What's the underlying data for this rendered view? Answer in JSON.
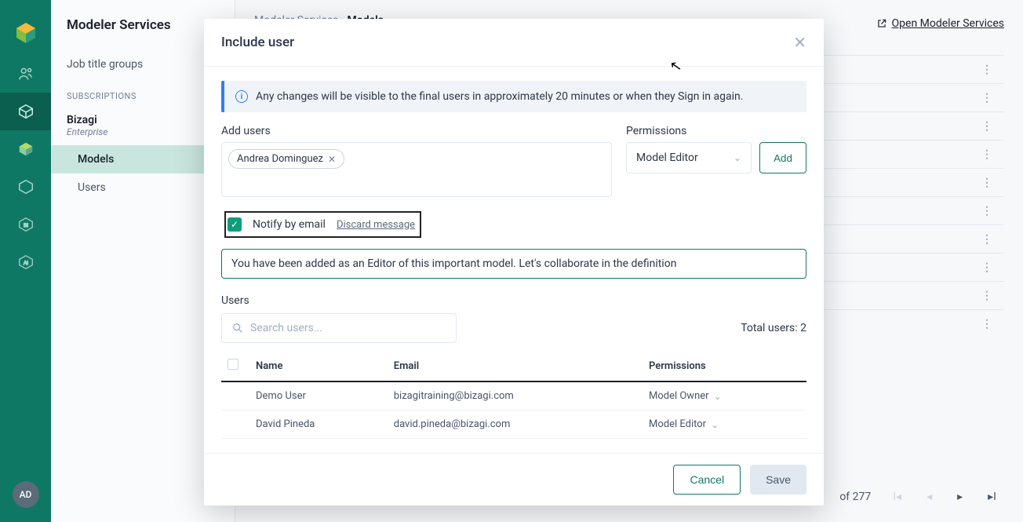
{
  "rail": {
    "avatar_initials": "AD"
  },
  "sidebar": {
    "title": "Modeler Services",
    "link_job_groups": "Job title groups",
    "section_subscriptions": "SUBSCRIPTIONS",
    "subscription_name": "Bizagi",
    "subscription_tier": "Enterprise",
    "item_models": "Models",
    "item_users": "Users"
  },
  "breadcrumb": {
    "root": "Modeler Services",
    "sep": "›",
    "current": "Models"
  },
  "open_link": "Open Modeler Services",
  "pagination": {
    "of_label": "of 277"
  },
  "modal": {
    "title": "Include user",
    "info": "Any changes will be visible to the final users in approximately 20 minutes or when they Sign in again.",
    "add_users_label": "Add users",
    "user_chip": "Andrea Dominguez",
    "permissions_label": "Permissions",
    "permissions_value": "Model Editor",
    "add_button": "Add",
    "notify_label": "Notify by email",
    "discard_label": "Discard message",
    "message_text": "You have been added as an Editor of this important model. Let's collaborate in the definition",
    "users_section_label": "Users",
    "search_placeholder": "Search users...",
    "total_users_label": "Total users: 2",
    "table": {
      "col_name": "Name",
      "col_email": "Email",
      "col_permissions": "Permissions",
      "rows": [
        {
          "name": "Demo User",
          "email": "bizagitraining@bizagi.com",
          "permission": "Model Owner"
        },
        {
          "name": "David Pineda",
          "email": "david.pineda@bizagi.com",
          "permission": "Model Editor"
        }
      ]
    },
    "cancel": "Cancel",
    "save": "Save"
  }
}
